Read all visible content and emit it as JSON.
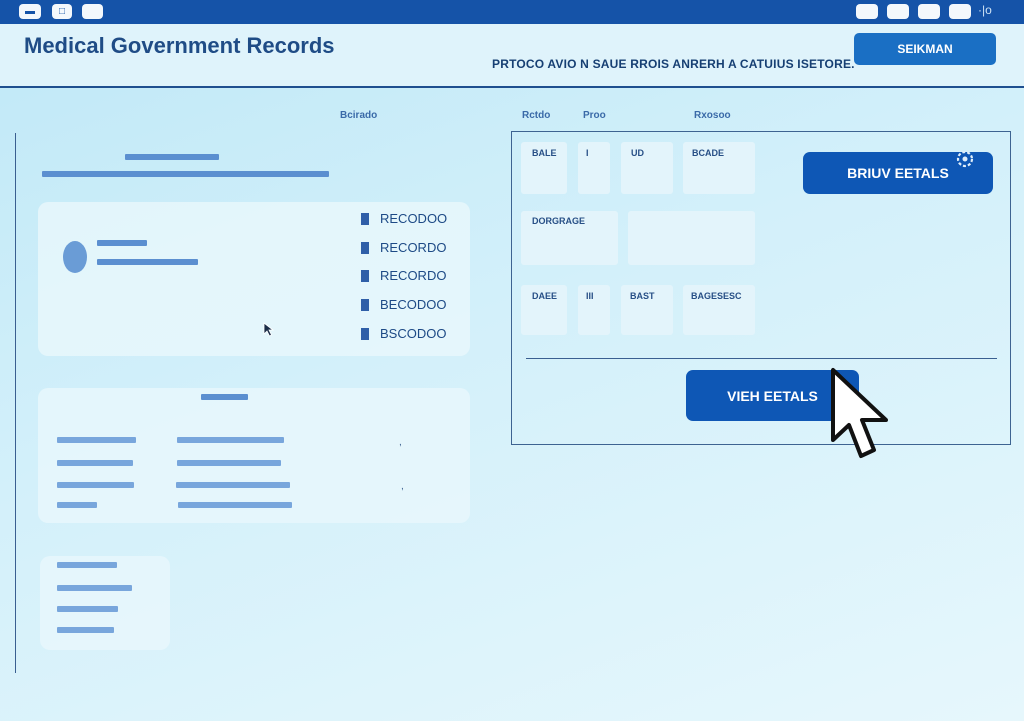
{
  "topbar": {
    "left_buttons": [
      "",
      "",
      ""
    ],
    "right_buttons": [
      "",
      "",
      "",
      ""
    ],
    "extra": "·|o"
  },
  "header": {
    "title": "Medical Government Records",
    "tagline": "PRTOCO AVIO N SAUE RROIS ANRERH A CATUIUS ISETORE.",
    "search_label": "SEIKMAN"
  },
  "left": {
    "column_label": "Bcirado",
    "records": [
      "RECODOO",
      "RECORDO",
      "RECORDO",
      "BECODOO",
      "BSCODOO"
    ]
  },
  "right": {
    "column_labels": [
      "Rctdo",
      "Proo",
      "Rxosoo"
    ],
    "fields_row1": [
      "BALE",
      "I",
      "UD",
      "BCADE"
    ],
    "fields_row2": [
      "DORGRAGE"
    ],
    "fields_row3": [
      "DAEE",
      "III",
      "BAST",
      "BAGESESC"
    ],
    "primary_button": "BRIUV EETALS",
    "view_button": "VIEH EETALS"
  },
  "colors": {
    "primary": "#0e57b5",
    "topbar": "#1553a8",
    "accent_bar": "#5b8fd0"
  }
}
